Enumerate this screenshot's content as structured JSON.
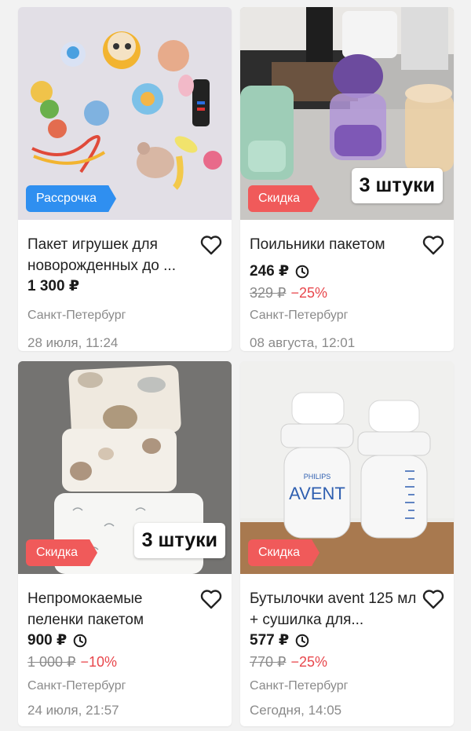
{
  "listings": [
    {
      "title": "Пакет игрушек для новорожденных до ...",
      "price": "1 300 ₽",
      "badge": "Рассрочка",
      "city": "Санкт-Петербург",
      "date": "28 июля, 11:24"
    },
    {
      "title": "Поильники пакетом",
      "price": "246 ₽",
      "old_price": "329 ₽",
      "discount": "−25%",
      "badge": "Скидка",
      "sticker": "3 штуки",
      "city": "Санкт-Петербург",
      "date": "08 августа, 12:01"
    },
    {
      "title": "Непромокаемые пеленки пакетом",
      "price": "900 ₽",
      "old_price": "1 000 ₽",
      "discount": "−10%",
      "badge": "Скидка",
      "sticker": "3 штуки",
      "city": "Санкт-Петербург",
      "date": "24 июля, 21:57"
    },
    {
      "title": "Бутылочки avent 125 мл + сушилка для...",
      "price": "577 ₽",
      "old_price": "770 ₽",
      "discount": "−25%",
      "badge": "Скидка",
      "city": "Санкт-Петербург",
      "date": "Сегодня, 14:05",
      "photo_labels": [
        "PHILIPS",
        "AVENT"
      ]
    }
  ],
  "colors": {
    "installment_badge": "#2f8ff0",
    "discount_badge": "#f05a5a",
    "discount_text": "#e8474c",
    "muted_text": "#8a8a8a"
  },
  "icons": {
    "favorite": "heart-outline-icon",
    "timer": "clock-icon"
  }
}
